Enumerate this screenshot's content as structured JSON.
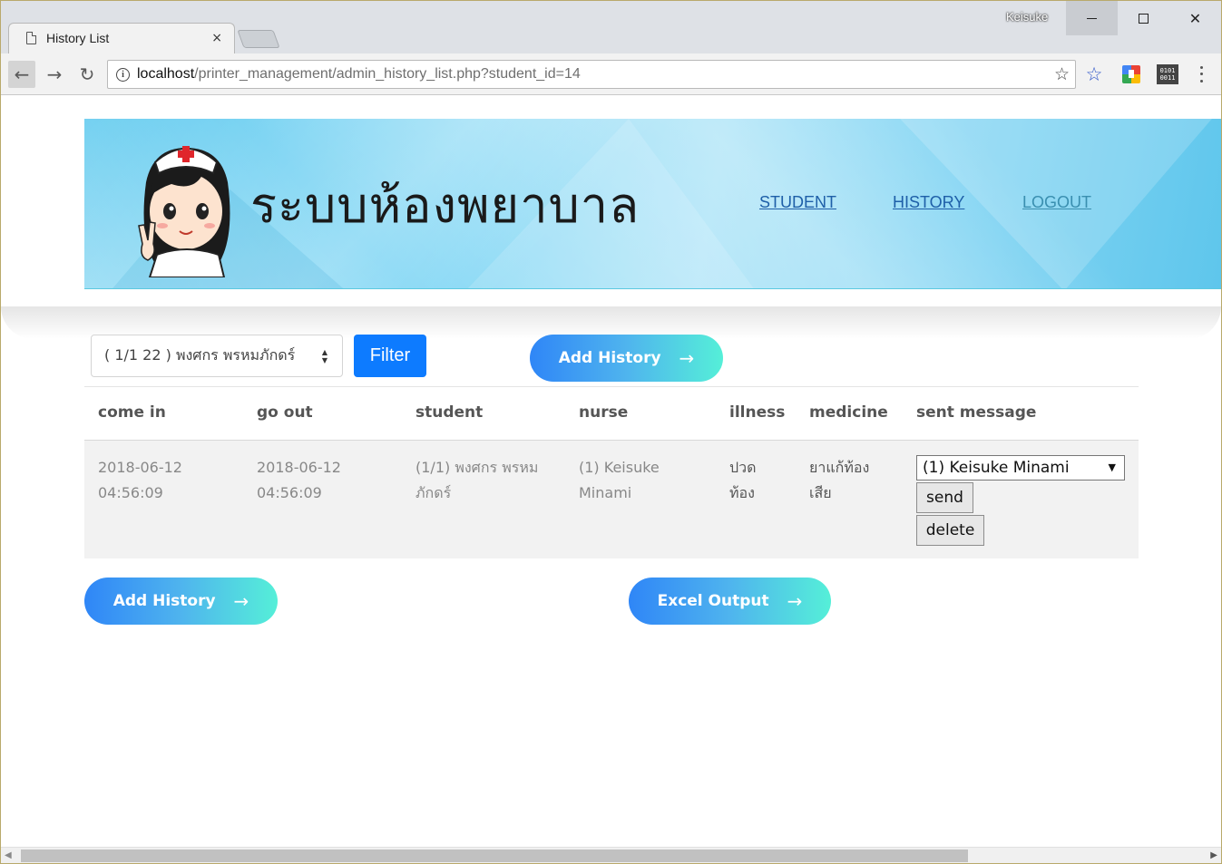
{
  "browser": {
    "tab_title": "History List",
    "tab_close": "×",
    "profile_name": "Keisuke",
    "url_host": "localhost",
    "url_path": "/printer_management/admin_history_list.php?student_id=14",
    "back_glyph": "←",
    "forward_glyph": "→",
    "reload_glyph": "↻",
    "bookmark_glyph": "☆",
    "ext_star_glyph": "☆",
    "ext_bin_line1": "0101",
    "ext_bin_line2": "0011",
    "close_glyph": "✕"
  },
  "header": {
    "site_title": "ระบบห้องพยาบาล",
    "nav": {
      "student": "STUDENT",
      "history": "HISTORY",
      "logout": "LOGOUT"
    }
  },
  "filter": {
    "selected_student": "( 1/1 22 ) พงศกร พรหมภักดร์",
    "filter_label": "Filter",
    "add_history_label": "Add History",
    "arrow_glyph": "→"
  },
  "table": {
    "columns": [
      "come in",
      "go out",
      "student",
      "nurse",
      "illness",
      "medicine",
      "sent message"
    ],
    "rows": [
      {
        "come_in_date": "2018-06-12",
        "come_in_time": "04:56:09",
        "go_out_date": "2018-06-12",
        "go_out_time": "04:56:09",
        "student_line1": "(1/1) พงศกร พรหม",
        "student_line2": "ภักดร์",
        "nurse_line1": "(1) Keisuke",
        "nurse_line2": "Minami",
        "illness_line1": "ปวด",
        "illness_line2": "ท้อง",
        "medicine_line1": "ยาแก้ท้อง",
        "medicine_line2": "เสีย",
        "message_recipient": "(1) Keisuke Minami",
        "send_label": "send",
        "delete_label": "delete"
      }
    ]
  },
  "footer_actions": {
    "add_history_label": "Add History",
    "excel_output_label": "Excel Output",
    "arrow_glyph": "→"
  },
  "colors": {
    "primary_blue": "#0d7bff",
    "pill_gradient_start": "#2f86f7",
    "pill_gradient_end": "#55efd8",
    "nav_link": "#1e5fa8"
  }
}
